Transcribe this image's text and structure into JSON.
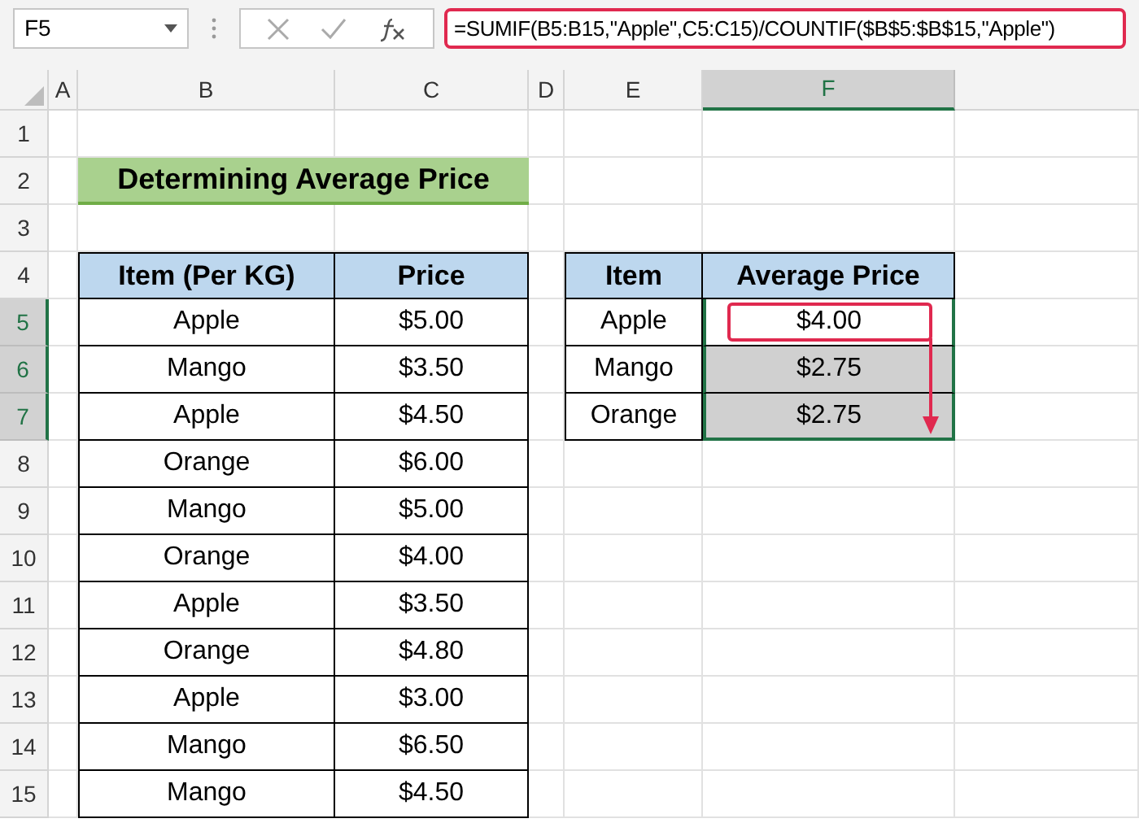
{
  "name_box": "F5",
  "formula": "=SUMIF(B5:B15,\"Apple\",C5:C15)/COUNTIF($B$5:$B$15,\"Apple\")",
  "columns": [
    {
      "label": "A",
      "selected": false
    },
    {
      "label": "B",
      "selected": false
    },
    {
      "label": "C",
      "selected": false
    },
    {
      "label": "D",
      "selected": false
    },
    {
      "label": "E",
      "selected": false
    },
    {
      "label": "F",
      "selected": true
    }
  ],
  "rows": [
    {
      "label": "1",
      "selected": false
    },
    {
      "label": "2",
      "selected": false
    },
    {
      "label": "3",
      "selected": false
    },
    {
      "label": "4",
      "selected": false
    },
    {
      "label": "5",
      "selected": true
    },
    {
      "label": "6",
      "selected": true
    },
    {
      "label": "7",
      "selected": true
    },
    {
      "label": "8",
      "selected": false
    },
    {
      "label": "9",
      "selected": false
    },
    {
      "label": "10",
      "selected": false
    },
    {
      "label": "11",
      "selected": false
    },
    {
      "label": "12",
      "selected": false
    },
    {
      "label": "13",
      "selected": false
    },
    {
      "label": "14",
      "selected": false
    },
    {
      "label": "15",
      "selected": false
    }
  ],
  "title": "Determining Average Price",
  "price_table": {
    "columns": [
      "Item (Per KG)",
      "Price"
    ],
    "rows": [
      [
        "Apple",
        "$5.00"
      ],
      [
        "Mango",
        "$3.50"
      ],
      [
        "Apple",
        "$4.50"
      ],
      [
        "Orange",
        "$6.00"
      ],
      [
        "Mango",
        "$5.00"
      ],
      [
        "Orange",
        "$4.00"
      ],
      [
        "Apple",
        "$3.50"
      ],
      [
        "Orange",
        "$4.80"
      ],
      [
        "Apple",
        "$3.00"
      ],
      [
        "Mango",
        "$6.50"
      ],
      [
        "Mango",
        "$4.50"
      ]
    ]
  },
  "average_table": {
    "columns": [
      "Item",
      "Average Price"
    ],
    "rows": [
      {
        "item": "Apple",
        "value": "$4.00",
        "selected": true,
        "active": true
      },
      {
        "item": "Mango",
        "value": "$2.75",
        "selected": true,
        "active": false
      },
      {
        "item": "Orange",
        "value": "$2.75",
        "selected": true,
        "active": false
      }
    ]
  }
}
